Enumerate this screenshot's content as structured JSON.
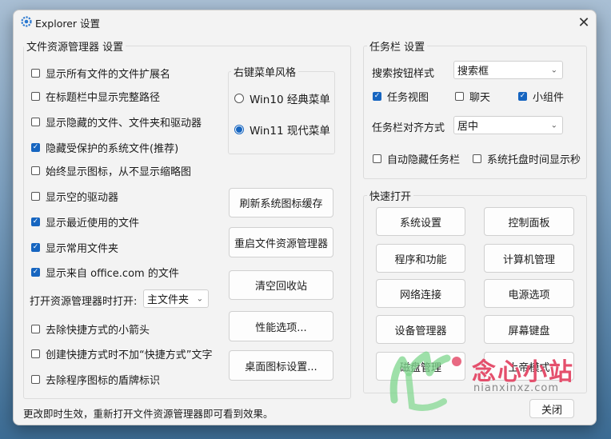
{
  "window": {
    "title": "Explorer 设置",
    "close_glyph": "✕"
  },
  "file_explorer": {
    "group_title": "文件资源管理器 设置",
    "checkboxes": [
      {
        "label": "显示所有文件的文件扩展名",
        "checked": false
      },
      {
        "label": "在标题栏中显示完整路径",
        "checked": false
      },
      {
        "label": "显示隐藏的文件、文件夹和驱动器",
        "checked": false
      },
      {
        "label": "隐藏受保护的系统文件(推荐)",
        "checked": true
      },
      {
        "label": "始终显示图标，从不显示缩略图",
        "checked": false
      },
      {
        "label": "显示空的驱动器",
        "checked": false
      },
      {
        "label": "显示最近使用的文件",
        "checked": true
      },
      {
        "label": "显示常用文件夹",
        "checked": true
      },
      {
        "label": "显示来自 office.com 的文件",
        "checked": true
      }
    ],
    "open_label": "打开资源管理器时打开:",
    "open_value": "主文件夹",
    "checkboxes_bottom": [
      {
        "label": "去除快捷方式的小箭头",
        "checked": false
      },
      {
        "label": "创建快捷方式时不加“快捷方式”文字",
        "checked": false
      },
      {
        "label": "去除程序图标的盾牌标识",
        "checked": false
      }
    ]
  },
  "context_menu": {
    "group_title": "右键菜单风格",
    "options": [
      {
        "label": "Win10 经典菜单",
        "checked": false
      },
      {
        "label": "Win11 现代菜单",
        "checked": true
      }
    ]
  },
  "action_buttons": [
    "刷新系统图标缓存",
    "重启文件资源管理器",
    "清空回收站",
    "性能选项...",
    "桌面图标设置..."
  ],
  "taskbar": {
    "group_title": "任务栏 设置",
    "search_label": "搜索按钮样式",
    "search_value": "搜索框",
    "toggles": [
      {
        "label": "任务视图",
        "checked": true
      },
      {
        "label": "聊天",
        "checked": false
      },
      {
        "label": "小组件",
        "checked": true
      }
    ],
    "align_label": "任务栏对齐方式",
    "align_value": "居中",
    "toggles2": [
      {
        "label": "自动隐藏任务栏",
        "checked": false
      },
      {
        "label": "系统托盘时间显示秒",
        "checked": false
      }
    ]
  },
  "quick_open": {
    "group_title": "快速打开",
    "buttons": [
      "系统设置",
      "控制面板",
      "程序和功能",
      "计算机管理",
      "网络连接",
      "电源选项",
      "设备管理器",
      "屏幕键盘",
      "磁盘管理",
      "上帝模式"
    ]
  },
  "status_text": "更改即时生效，重新打开文件资源管理器即可看到效果。",
  "close_button": "关闭",
  "watermark": {
    "text": "念心小站",
    "url": "nianxinxz.com"
  },
  "colors": {
    "accent": "#1665c0",
    "dialog_bg": "#f3f3f3",
    "watermark": "#e44f6c"
  }
}
